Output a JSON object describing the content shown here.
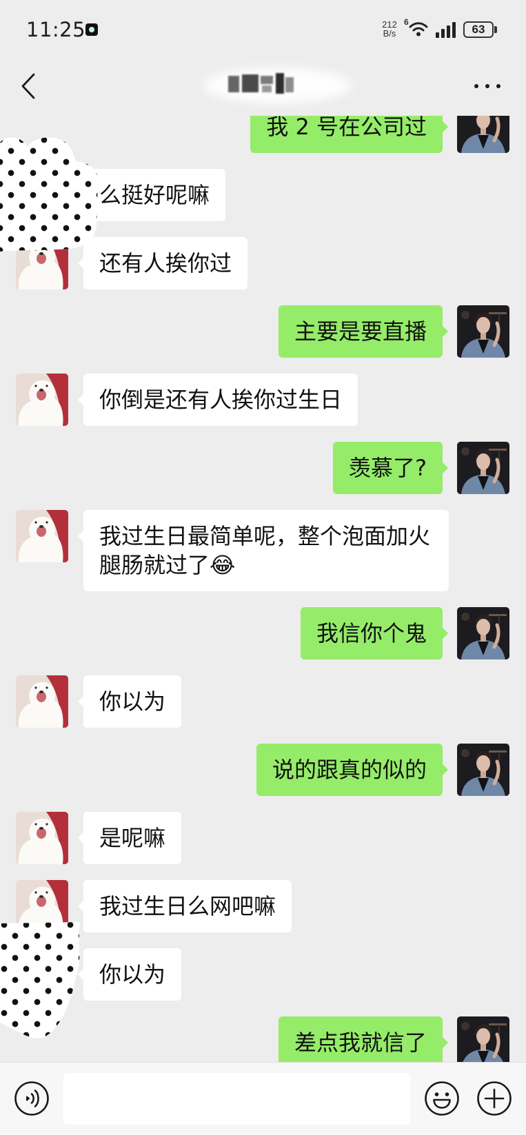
{
  "status_bar": {
    "time": "11:25",
    "net_speed": "212",
    "net_speed_unit": "B/s",
    "wifi_generation": "6",
    "battery_level": "63"
  },
  "header": {
    "icons": {
      "back": "chevron-left-icon",
      "more": "more-horizontal-icon"
    }
  },
  "messages": [
    {
      "text": "我 2 号在公司过"
    },
    {
      "text": "么挺好呢嘛"
    },
    {
      "text": "还有人挨你过"
    },
    {
      "text": "主要是要直播"
    },
    {
      "text": "你倒是还有人挨你过生日"
    },
    {
      "text": "羡慕了?"
    },
    {
      "text": "我过生日最简单呢，整个泡面加火腿肠就过了😂"
    },
    {
      "text": "我信你个鬼"
    },
    {
      "text": "你以为"
    },
    {
      "text": "说的跟真的似的"
    },
    {
      "text": "是呢嘛"
    },
    {
      "text": "我过生日么网吧嘛"
    },
    {
      "text": "你以为"
    },
    {
      "text": "差点我就信了"
    }
  ],
  "input_bar": {
    "icons": {
      "voice": "voice-icon",
      "emoji": "emoji-icon",
      "plus": "plus-icon"
    }
  },
  "colors": {
    "background": "#ededed",
    "outgoing_bubble": "#95ec69",
    "incoming_bubble": "#ffffff",
    "text": "#191919",
    "input_bar": "#f7f7f7"
  }
}
